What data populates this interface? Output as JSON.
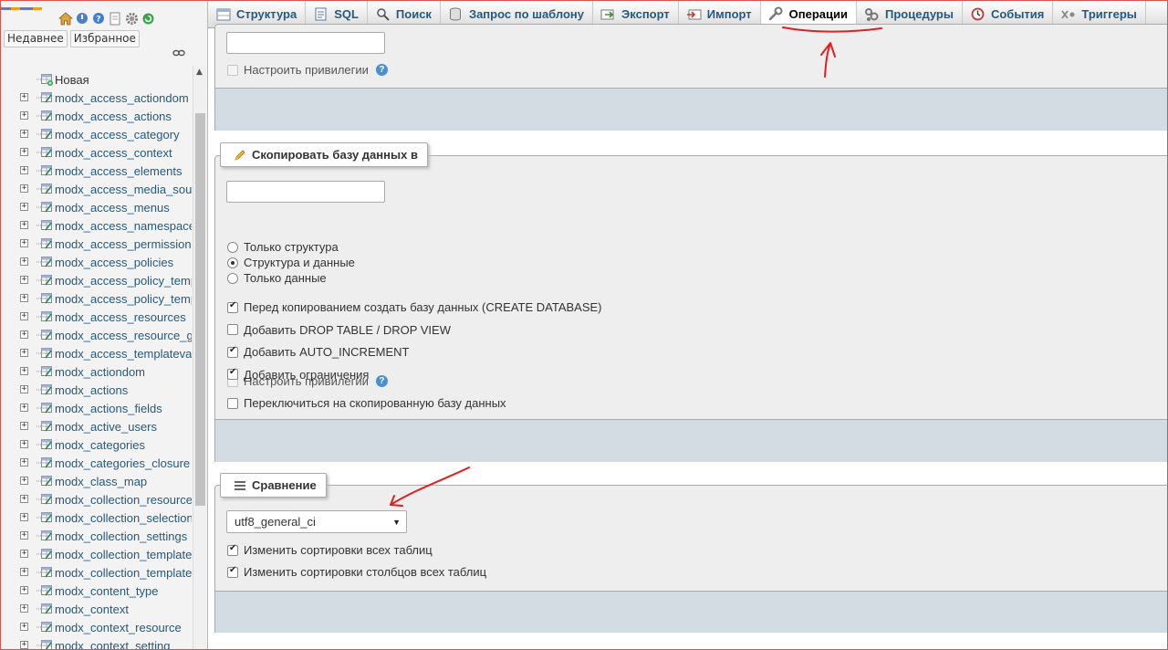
{
  "sidebar": {
    "tabs": [
      "Недавнее",
      "Избранное"
    ],
    "new_item": "Новая",
    "tables": [
      "modx_access_actiondom",
      "modx_access_actions",
      "modx_access_category",
      "modx_access_context",
      "modx_access_elements",
      "modx_access_media_sou",
      "modx_access_menus",
      "modx_access_namespace",
      "modx_access_permissions",
      "modx_access_policies",
      "modx_access_policy_temp",
      "modx_access_policy_temp",
      "modx_access_resources",
      "modx_access_resource_g",
      "modx_access_templatevar",
      "modx_actiondom",
      "modx_actions",
      "modx_actions_fields",
      "modx_active_users",
      "modx_categories",
      "modx_categories_closure",
      "modx_class_map",
      "modx_collection_resource_",
      "modx_collection_selection",
      "modx_collection_settings",
      "modx_collection_templates",
      "modx_collection_template_",
      "modx_content_type",
      "modx_context",
      "modx_context_resource",
      "modx_context_setting"
    ]
  },
  "tabs": [
    {
      "label": "Структура",
      "icon": "structure-icon"
    },
    {
      "label": "SQL",
      "icon": "sql-icon"
    },
    {
      "label": "Поиск",
      "icon": "search-icon"
    },
    {
      "label": "Запрос по шаблону",
      "icon": "query-icon"
    },
    {
      "label": "Экспорт",
      "icon": "export-icon"
    },
    {
      "label": "Импорт",
      "icon": "import-icon"
    },
    {
      "label": "Операции",
      "icon": "wrench-icon",
      "active": true
    },
    {
      "label": "Процедуры",
      "icon": "routines-icon"
    },
    {
      "label": "События",
      "icon": "events-icon"
    },
    {
      "label": "Триггеры",
      "icon": "triggers-icon"
    }
  ],
  "rename": {
    "input_value": "",
    "privileges_label": "Настроить привилегии"
  },
  "copy": {
    "legend": "Скопировать базу данных в",
    "input_value": "",
    "radios": [
      {
        "label": "Только структура",
        "checked": false
      },
      {
        "label": "Структура и данные",
        "checked": true
      },
      {
        "label": "Только данные",
        "checked": false
      }
    ],
    "checks": [
      {
        "label": "Перед копированием создать базу данных (CREATE DATABASE)",
        "checked": true
      },
      {
        "label": "Добавить DROP TABLE / DROP VIEW",
        "checked": false
      },
      {
        "label": "Добавить AUTO_INCREMENT",
        "checked": true
      },
      {
        "label": "Добавить ограничения",
        "checked": true
      }
    ],
    "privileges_label": "Настроить привилегии",
    "switch_label": "Переключиться на скопированную базу данных",
    "switch_checked": false
  },
  "collation": {
    "legend": "Сравнение",
    "selected": "utf8_general_ci",
    "checks": [
      {
        "label": "Изменить сортировки всех таблиц",
        "checked": true
      },
      {
        "label": "Изменить сортировки столбцов всех таблиц",
        "checked": true
      }
    ]
  },
  "colors": {
    "link": "#235a81",
    "annotation": "#e02020",
    "footer": "#d3dce3",
    "fieldset_bg": "#eeeeee"
  }
}
